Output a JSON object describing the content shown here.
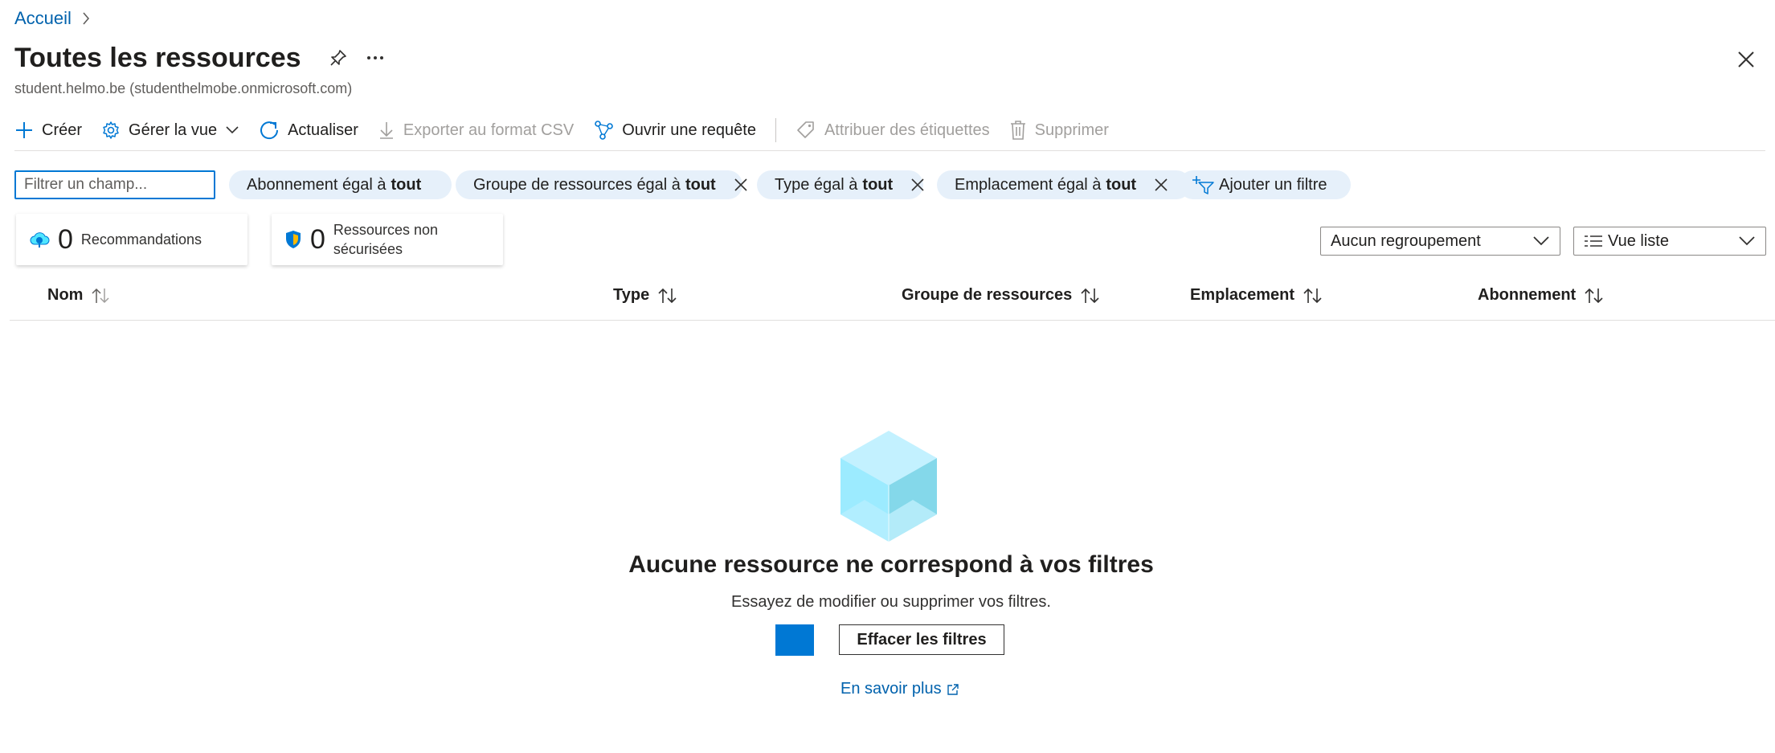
{
  "breadcrumb": {
    "home": "Accueil"
  },
  "header": {
    "title": "Toutes les ressources",
    "subtitle": "student.helmo.be (studenthelmobe.onmicrosoft.com)"
  },
  "toolbar": {
    "create": "Créer",
    "manage_view": "Gérer la vue",
    "refresh": "Actualiser",
    "export_csv": "Exporter au format CSV",
    "open_query": "Ouvrir une requête",
    "assign_tags": "Attribuer des étiquettes",
    "delete": "Supprimer"
  },
  "filters": {
    "search_placeholder": "Filtrer un champ...",
    "pills": [
      {
        "prefix": "Abonnement égal à",
        "value": "tout"
      },
      {
        "prefix": "Groupe de ressources égal à",
        "value": "tout"
      },
      {
        "prefix": "Type égal à",
        "value": "tout"
      },
      {
        "prefix": "Emplacement égal à",
        "value": "tout"
      }
    ],
    "add_filter": "Ajouter un filtre"
  },
  "summary": {
    "recommendations": {
      "count": "0",
      "label": "Recommandations"
    },
    "unsecured": {
      "count": "0",
      "label_line1": "Ressources non",
      "label_line2": "sécurisées"
    }
  },
  "grouping": {
    "selected": "Aucun regroupement"
  },
  "view": {
    "selected": "Vue liste"
  },
  "table": {
    "columns": [
      "Nom",
      "Type",
      "Groupe de ressources",
      "Emplacement",
      "Abonnement"
    ]
  },
  "empty_state": {
    "title": "Aucune ressource ne correspond à vos filtres",
    "description": "Essayez de modifier ou supprimer vos filtres.",
    "clear_button": "Effacer les filtres",
    "learn_more": "En savoir plus"
  },
  "colors": {
    "accent": "#0078d4",
    "link": "#0062ad",
    "pill_bg": "#e6f0fa"
  }
}
